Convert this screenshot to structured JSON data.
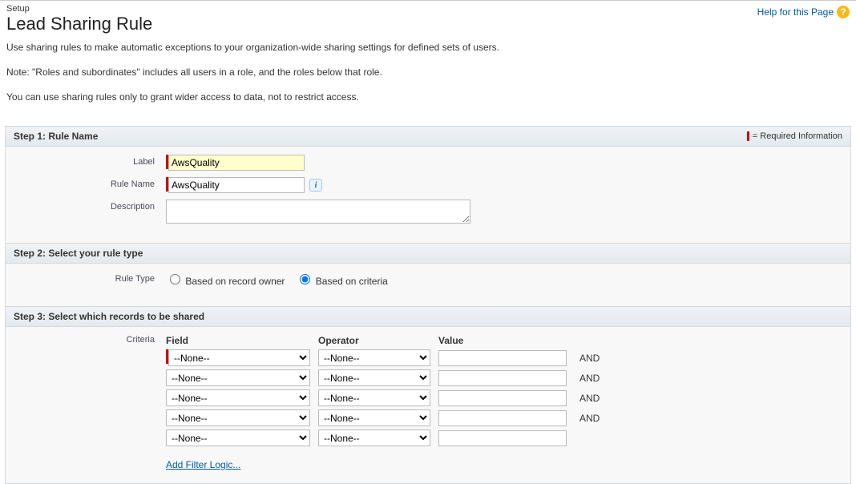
{
  "header": {
    "setup": "Setup",
    "title": "Lead Sharing Rule",
    "help_link": "Help for this Page"
  },
  "intro": {
    "p1": "Use sharing rules to make automatic exceptions to your organization-wide sharing settings for defined sets of users.",
    "p2": "Note: \"Roles and subordinates\" includes all users in a role, and the roles below that role.",
    "p3": "You can use sharing rules only to grant wider access to data, not to restrict access."
  },
  "step1": {
    "title": "Step 1: Rule Name",
    "req_text": "= Required Information",
    "labels": {
      "label": "Label",
      "rule_name": "Rule Name",
      "description": "Description"
    },
    "values": {
      "label": "AwsQuality",
      "rule_name": "AwsQuality",
      "description": ""
    }
  },
  "step2": {
    "title": "Step 2: Select your rule type",
    "labels": {
      "rule_type": "Rule Type"
    },
    "options": {
      "owner": "Based on record owner",
      "criteria": "Based on criteria"
    }
  },
  "step3": {
    "title": "Step 3: Select which records to be shared",
    "labels": {
      "criteria": "Criteria"
    },
    "headers": {
      "field": "Field",
      "operator": "Operator",
      "value": "Value"
    },
    "none_option": "--None--",
    "and": "AND",
    "add_filter": "Add Filter Logic...",
    "rows": [
      {
        "field": "--None--",
        "operator": "--None--",
        "value": "",
        "and": true,
        "required": true
      },
      {
        "field": "--None--",
        "operator": "--None--",
        "value": "",
        "and": true,
        "required": false
      },
      {
        "field": "--None--",
        "operator": "--None--",
        "value": "",
        "and": true,
        "required": false
      },
      {
        "field": "--None--",
        "operator": "--None--",
        "value": "",
        "and": true,
        "required": false
      },
      {
        "field": "--None--",
        "operator": "--None--",
        "value": "",
        "and": false,
        "required": false
      }
    ]
  }
}
